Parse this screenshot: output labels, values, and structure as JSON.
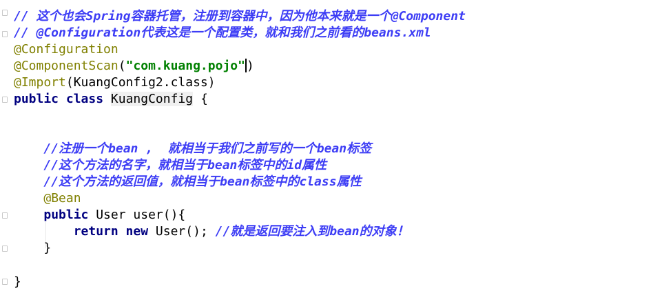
{
  "editor": {
    "lines": [
      [
        {
          "t": "comment",
          "v": "// 这个也会Spring容器托管，注册到容器中，因为他本来就是一个@Component"
        }
      ],
      [
        {
          "t": "comment",
          "v": "// @Configuration代表这是一个配置类，就和我们之前看的beans.xml"
        }
      ],
      [
        {
          "t": "ann",
          "v": "@Configuration"
        }
      ],
      [
        {
          "t": "ann",
          "v": "@ComponentScan"
        },
        {
          "t": "plain",
          "v": "("
        },
        {
          "t": "str",
          "v": "\"com.kuang.pojo\""
        },
        {
          "t": "caret",
          "v": ""
        },
        {
          "t": "plain",
          "v": ")"
        }
      ],
      [
        {
          "t": "ann",
          "v": "@Import"
        },
        {
          "t": "plain",
          "v": "(KuangConfig2.class)"
        }
      ],
      [
        {
          "t": "kw",
          "v": "public class "
        },
        {
          "t": "cls-hl",
          "v": "KuangConfig"
        },
        {
          "t": "plain",
          "v": " {"
        }
      ],
      [],
      [],
      [
        {
          "t": "plain",
          "v": "    "
        },
        {
          "t": "comment",
          "v": "//注册一个bean ,  就相当于我们之前写的一个bean标签"
        }
      ],
      [
        {
          "t": "plain",
          "v": "    "
        },
        {
          "t": "comment",
          "v": "//这个方法的名字，就相当于bean标签中的id属性"
        }
      ],
      [
        {
          "t": "plain",
          "v": "    "
        },
        {
          "t": "comment",
          "v": "//这个方法的返回值，就相当于bean标签中的class属性"
        }
      ],
      [
        {
          "t": "plain",
          "v": "    "
        },
        {
          "t": "ann",
          "v": "@Bean"
        }
      ],
      [
        {
          "t": "plain",
          "v": "    "
        },
        {
          "t": "kw",
          "v": "public "
        },
        {
          "t": "plain",
          "v": "User user(){"
        }
      ],
      [
        {
          "t": "plain",
          "v": "        "
        },
        {
          "t": "kw",
          "v": "return new "
        },
        {
          "t": "plain",
          "v": "User(); "
        },
        {
          "t": "comment",
          "v": "//就是返回要注入到bean的对象！"
        }
      ],
      [
        {
          "t": "plain",
          "v": "    }"
        }
      ],
      [],
      [
        {
          "t": "plain",
          "v": "}"
        }
      ]
    ]
  }
}
